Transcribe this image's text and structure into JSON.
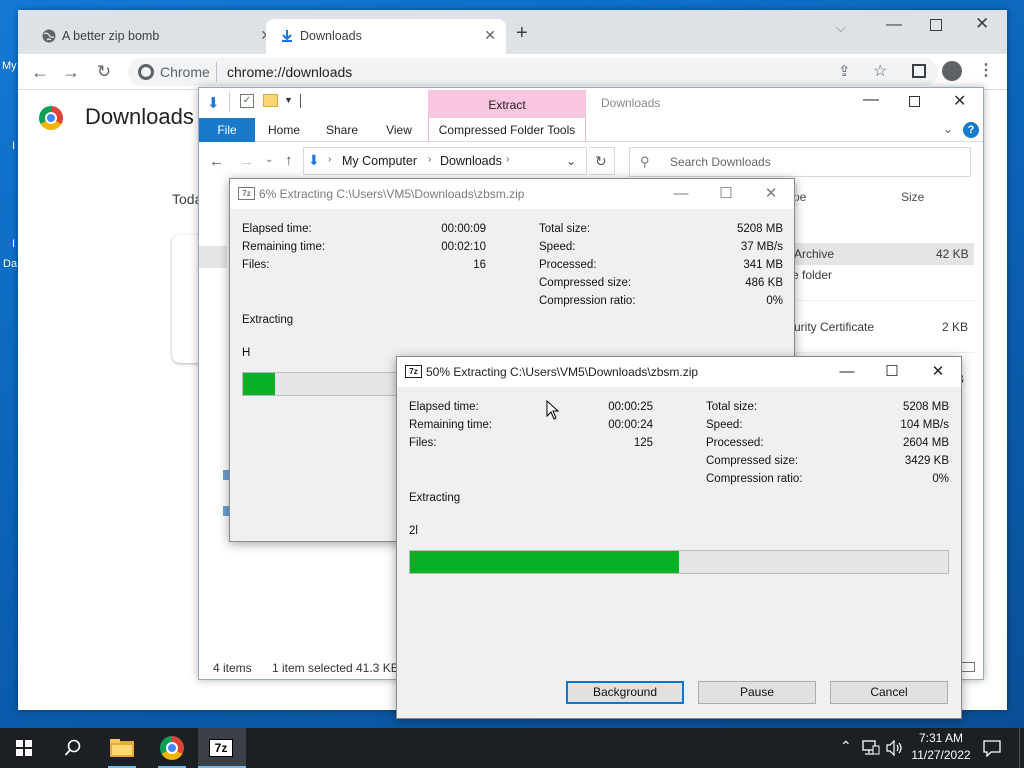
{
  "desktop": {
    "left_labels": [
      "My",
      "I",
      "I",
      "Da"
    ]
  },
  "chrome": {
    "tabs": [
      {
        "title": "A better zip bomb",
        "icon": "globe-icon",
        "active": false
      },
      {
        "title": "Downloads",
        "icon": "download-icon",
        "active": true
      }
    ],
    "new_tab": "+",
    "omnibox": {
      "site_label": "Chrome",
      "url": "chrome://downloads"
    },
    "page_title": "Downloads",
    "today_label": "Toda"
  },
  "explorer": {
    "ribbon_contextual": "Extract",
    "window_title": "Downloads",
    "tabs": [
      "File",
      "Home",
      "Share",
      "View",
      "Compressed Folder Tools"
    ],
    "breadcrumb": [
      "My Computer",
      "Downloads"
    ],
    "search_placeholder": "Search Downloads",
    "column_type": "pe",
    "column_size": "Size",
    "rows": [
      {
        "type": "Archive",
        "size": "42 KB"
      },
      {
        "type": "e folder",
        "size": ""
      },
      {
        "type": "curity Certificate",
        "size": "2 KB"
      },
      {
        "type": "",
        "size": "B"
      }
    ],
    "status": {
      "items": "4 items",
      "selected": "1 item selected",
      "size": "41.3 KB"
    }
  },
  "zip_back": {
    "title": "6% Extracting C:\\Users\\VM5\\Downloads\\zbsm.zip",
    "left": [
      {
        "label": "Elapsed time:",
        "value": "00:00:09"
      },
      {
        "label": "Remaining time:",
        "value": "00:02:10"
      },
      {
        "label": "Files:",
        "value": "16"
      }
    ],
    "right": [
      {
        "label": "Total size:",
        "value": "5208 MB"
      },
      {
        "label": "Speed:",
        "value": "37 MB/s"
      },
      {
        "label": "Processed:",
        "value": "341 MB"
      },
      {
        "label": "Compressed size:",
        "value": "486 KB"
      },
      {
        "label": "Compression ratio:",
        "value": "0%"
      }
    ],
    "status": "Extracting",
    "current_file": "H",
    "progress": 0.06
  },
  "zip_front": {
    "title": "50% Extracting C:\\Users\\VM5\\Downloads\\zbsm.zip",
    "left": [
      {
        "label": "Elapsed time:",
        "value": "00:00:25"
      },
      {
        "label": "Remaining time:",
        "value": "00:00:24"
      },
      {
        "label": "Files:",
        "value": "125"
      }
    ],
    "right": [
      {
        "label": "Total size:",
        "value": "5208 MB"
      },
      {
        "label": "Speed:",
        "value": "104 MB/s"
      },
      {
        "label": "Processed:",
        "value": "2604 MB"
      },
      {
        "label": "Compressed size:",
        "value": "3429 KB"
      },
      {
        "label": "Compression ratio:",
        "value": "0%"
      }
    ],
    "status": "Extracting",
    "current_file": "2l",
    "progress": 0.5,
    "buttons": {
      "background": "Background",
      "pause": "Pause",
      "cancel": "Cancel"
    }
  },
  "taskbar": {
    "time": "7:31 AM",
    "date": "11/27/2022",
    "pinned": [
      "start-icon",
      "search-icon",
      "file-explorer-icon",
      "chrome-icon",
      "7zip-icon"
    ],
    "seven_zip_label": "7z"
  },
  "colors": {
    "progress_fill": "#06b025",
    "accent": "#0078d7",
    "contextual_tab": "#f9c6e0"
  }
}
